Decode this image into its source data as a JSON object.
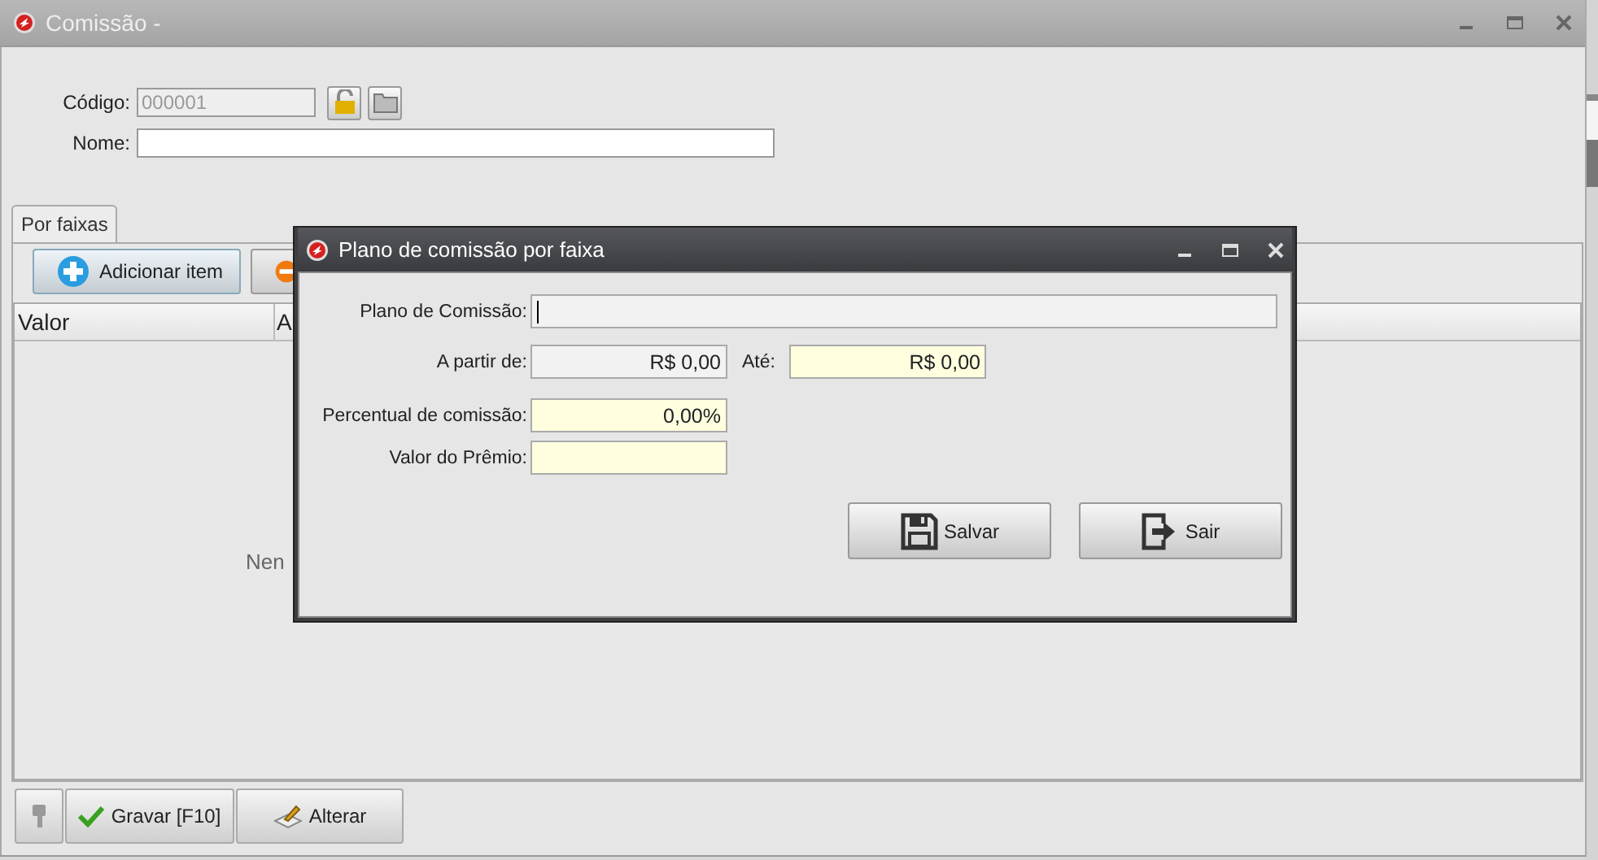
{
  "window": {
    "title": "Comissão -"
  },
  "form": {
    "code": {
      "label": "Código:",
      "value": "000001",
      "disabled": true
    },
    "name": {
      "label": "Nome:"
    }
  },
  "tabs": [
    {
      "label": "Por faixas",
      "selected": true
    }
  ],
  "toolbar": [
    {
      "kind": "add",
      "label": "Adicionar item"
    },
    {
      "kind": "remove"
    }
  ],
  "grid": {
    "columns": [
      "Valor",
      "A"
    ],
    "empty_message": "Nen"
  },
  "footer": [
    {
      "kind": "key"
    },
    {
      "kind": "check",
      "label": "Gravar [F10]"
    },
    {
      "kind": "edit",
      "label": "Alterar"
    }
  ],
  "dialog": {
    "title": "Plano de comissão por faixa",
    "rows": [
      {
        "fields": [
          {
            "kind": "wide",
            "label": "Plano de Comissão:",
            "highlighted": false,
            "focused": true
          }
        ]
      },
      {
        "fields": [
          {
            "kind": "short",
            "label": "A partir de:",
            "value": "R$ 0,00",
            "highlighted": false,
            "focused": false
          },
          {
            "kind": "short",
            "label": "Até:",
            "value": "R$ 0,00",
            "highlighted": true,
            "focused": false
          }
        ]
      },
      {
        "fields": [
          {
            "kind": "short",
            "label": "Percentual de comissão:",
            "value": "0,00%",
            "highlighted": true,
            "focused": false
          }
        ]
      },
      {
        "fields": [
          {
            "kind": "short",
            "label": "Valor do Prêmio:",
            "highlighted": true,
            "focused": false
          }
        ]
      }
    ],
    "buttons": [
      {
        "kind": "save",
        "label": "Salvar"
      },
      {
        "kind": "exit",
        "label": "Sair"
      }
    ]
  }
}
